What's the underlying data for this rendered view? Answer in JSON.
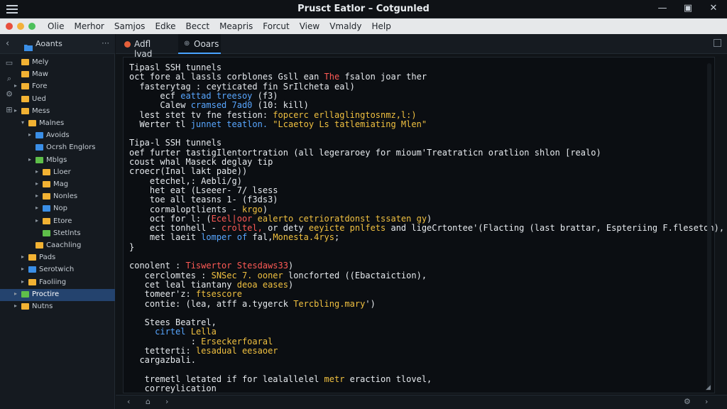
{
  "window": {
    "title": "Prusct Eatlor – Cotgunled"
  },
  "menubar": {
    "items": [
      "Olie",
      "Merhor",
      "Samjos",
      "Edke",
      "Becct",
      "Meapris",
      "Forcut",
      "View",
      "Vmaldy",
      "Help"
    ],
    "traffic_colors": [
      "#e84e3c",
      "#f3b13a",
      "#4cc05a"
    ]
  },
  "sidebar": {
    "title": "Aoants",
    "tree": [
      {
        "label": "Mely",
        "indent": 1,
        "chev": "",
        "color": "#f2b233"
      },
      {
        "label": "Maw",
        "indent": 1,
        "chev": "",
        "color": "#f2b233"
      },
      {
        "label": "Fore",
        "indent": 1,
        "chev": "▸",
        "color": "#f2b233"
      },
      {
        "label": "Ued",
        "indent": 1,
        "chev": "",
        "color": "#f2b233"
      },
      {
        "label": "Mess",
        "indent": 1,
        "chev": "▸",
        "color": "#f2b233"
      },
      {
        "label": "Malnes",
        "indent": 2,
        "chev": "▾",
        "color": "#f2b233"
      },
      {
        "label": "Avoids",
        "indent": 3,
        "chev": "▸",
        "color": "#3a8ee6"
      },
      {
        "label": "Ocrsh Englors",
        "indent": 3,
        "chev": "",
        "color": "#3a8ee6"
      },
      {
        "label": "Mblgs",
        "indent": 3,
        "chev": "▸",
        "color": "#5fbf4a"
      },
      {
        "label": "Lloer",
        "indent": 4,
        "chev": "▸",
        "color": "#f2b233"
      },
      {
        "label": "Mag",
        "indent": 4,
        "chev": "▸",
        "color": "#f2b233"
      },
      {
        "label": "Nonles",
        "indent": 4,
        "chev": "▸",
        "color": "#f2b233"
      },
      {
        "label": "Nop",
        "indent": 4,
        "chev": "▸",
        "color": "#3a8ee6"
      },
      {
        "label": "Etore",
        "indent": 4,
        "chev": "▸",
        "color": "#f2b233"
      },
      {
        "label": "Stetlnts",
        "indent": 4,
        "chev": "",
        "color": "#5fbf4a"
      },
      {
        "label": "Caachling",
        "indent": 3,
        "chev": "",
        "color": "#f2b233"
      },
      {
        "label": "Pads",
        "indent": 2,
        "chev": "▸",
        "color": "#f2b233"
      },
      {
        "label": "Serotwich",
        "indent": 2,
        "chev": "▸",
        "color": "#3a8ee6"
      },
      {
        "label": "Faoliing",
        "indent": 2,
        "chev": "▸",
        "color": "#f2b233"
      },
      {
        "label": "Proctire",
        "indent": 1,
        "chev": "▸",
        "color": "#5fbf4a",
        "selected": true
      },
      {
        "label": "Nutns",
        "indent": 1,
        "chev": "▸",
        "color": "#f2b233"
      }
    ]
  },
  "tabs": [
    {
      "label": "Adfl lvad",
      "active": false,
      "dot": true
    },
    {
      "label": "Ooars",
      "active": true,
      "dot": false
    }
  ],
  "editor": {
    "lines": [
      [
        {
          "t": "Tipasl SSH tunnels"
        }
      ],
      [
        {
          "t": "oct fore al lassls corblones Gsll ean "
        },
        {
          "t": "The",
          "c": "kw-red"
        },
        {
          "t": " fsalon joar ther"
        }
      ],
      [
        {
          "t": "  fasterytag : ceyticated fin SrIlcheta eal)"
        }
      ],
      [
        {
          "t": "      ecf "
        },
        {
          "t": "eattad treesoy",
          "c": "kw-blue"
        },
        {
          "t": " (f3)"
        }
      ],
      [
        {
          "t": "      Calew "
        },
        {
          "t": "cramsed 7ad0",
          "c": "kw-blue"
        },
        {
          "t": " (10: kill)"
        }
      ],
      [
        {
          "t": "  lest stet tv fne festion: "
        },
        {
          "t": "fopcerc erllaglingtosnmz,l:)",
          "c": "kw-yellow"
        }
      ],
      [
        {
          "t": "  Werter tl "
        },
        {
          "t": "junnet teatlon.",
          "c": "kw-blue"
        },
        {
          "t": " \"Lcaetoy Ls tatlemiating Mlen\"",
          "c": "kw-yellow"
        }
      ],
      [
        {
          "t": ""
        }
      ],
      [
        {
          "t": "Tipa-l SSH tunnels"
        }
      ],
      [
        {
          "t": "oef furter tastigIlentortration (all legeraroey for mioum'Treatraticn oratlion shlon [realo)"
        }
      ],
      [
        {
          "t": "coust whal Maseck deglay tip"
        }
      ],
      [
        {
          "t": "croecr(Inal lakt pabe))"
        }
      ],
      [
        {
          "t": "    etechel,: Aebli/g)"
        }
      ],
      [
        {
          "t": "    het eat (Lseeer- 7/ lsess"
        }
      ],
      [
        {
          "t": "    toe all teasns 1- (f3ds3)"
        }
      ],
      [
        {
          "t": "    cormaloptlients - "
        },
        {
          "t": "krgo",
          "c": "kw-yellow"
        },
        {
          "t": ")"
        }
      ],
      [
        {
          "t": "    oct for l: ("
        },
        {
          "t": "Ecel|oor",
          "c": "kw-red"
        },
        {
          "t": " "
        },
        {
          "t": "ealerto cetrioratdonst tssaten gy",
          "c": "kw-yellow"
        },
        {
          "t": ")"
        }
      ],
      [
        {
          "t": "    ect tonhell - "
        },
        {
          "t": "croltel,",
          "c": "kw-red"
        },
        {
          "t": " or dety "
        },
        {
          "t": "eeyicte pnlfets",
          "c": "kw-yellow"
        },
        {
          "t": " and ligeCrtontee'(Flacting (last brattar, Espteriing F.fleseton),"
        }
      ],
      [
        {
          "t": "    met laeit "
        },
        {
          "t": "lomper of",
          "c": "kw-blue"
        },
        {
          "t": " fal,"
        },
        {
          "t": "Monesta.4rys",
          "c": "kw-yellow"
        },
        {
          "t": ";"
        }
      ],
      [
        {
          "t": "}"
        }
      ],
      [
        {
          "t": ""
        }
      ],
      [
        {
          "t": "conolent : "
        },
        {
          "t": "Tiswertor Stesdaws33",
          "c": "kw-red"
        },
        {
          "t": ")"
        }
      ],
      [
        {
          "t": "   cerclomtes : "
        },
        {
          "t": "SNSec 7. ooner",
          "c": "kw-yellow"
        },
        {
          "t": " loncforted ((Ebactaiction),"
        }
      ],
      [
        {
          "t": "   cet leal tiantany "
        },
        {
          "t": "deoa eases",
          "c": "kw-yellow"
        },
        {
          "t": ")"
        }
      ],
      [
        {
          "t": "   tomeer'z: "
        },
        {
          "t": "ftsescore",
          "c": "kw-yellow"
        }
      ],
      [
        {
          "t": "   contie: (lea, atff a.tygerck "
        },
        {
          "t": "Tercbling.mary",
          "c": "kw-yellow"
        },
        {
          "t": "')"
        }
      ],
      [
        {
          "t": ""
        }
      ],
      [
        {
          "t": "   Stees Beatrel,"
        }
      ],
      [
        {
          "t": "     "
        },
        {
          "t": "cirtel",
          "c": "kw-blue"
        },
        {
          "t": " "
        },
        {
          "t": "Lella",
          "c": "kw-yellow"
        }
      ],
      [
        {
          "t": "            : "
        },
        {
          "t": "Erseckerfoaral",
          "c": "kw-yellow"
        }
      ],
      [
        {
          "t": "   tetterti: "
        },
        {
          "t": "lesadual eesaoer",
          "c": "kw-yellow"
        }
      ],
      [
        {
          "t": "  cargazbali."
        }
      ],
      [
        {
          "t": ""
        }
      ],
      [
        {
          "t": "   tremetl letated if for lealallelel "
        },
        {
          "t": "metr",
          "c": "kw-yellow"
        },
        {
          "t": " eraction tlovel,"
        }
      ],
      [
        {
          "t": "   correylication"
        }
      ]
    ]
  }
}
